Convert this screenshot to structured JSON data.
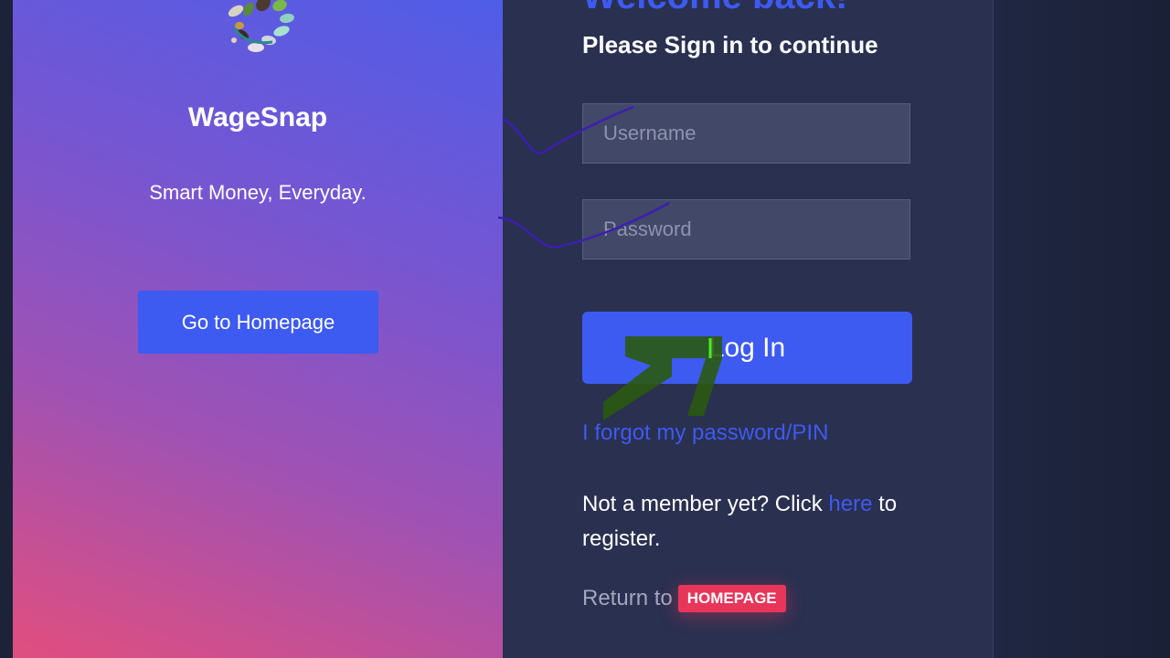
{
  "hero": {
    "brand": "WageSnap",
    "tagline": "Smart Money, Everyday.",
    "homepage_button": "Go to Homepage",
    "logo_icon": "leaf-wreath-logo"
  },
  "form": {
    "welcome": "Welcome back!",
    "subtitle": "Please Sign in to continue",
    "username_placeholder": "Username",
    "password_placeholder": "Password",
    "login_button": "Log In",
    "forgot_link": "I forgot my password/PIN",
    "register_prefix": "Not a member yet? Click",
    "register_link": "here",
    "register_suffix": "to register.",
    "return_text": "Return to",
    "return_badge": "HOMEPAGE"
  },
  "colors": {
    "accent": "#3d5af1",
    "badge": "#e8365a",
    "panel": "#2a3050",
    "background": "#1f2742"
  }
}
